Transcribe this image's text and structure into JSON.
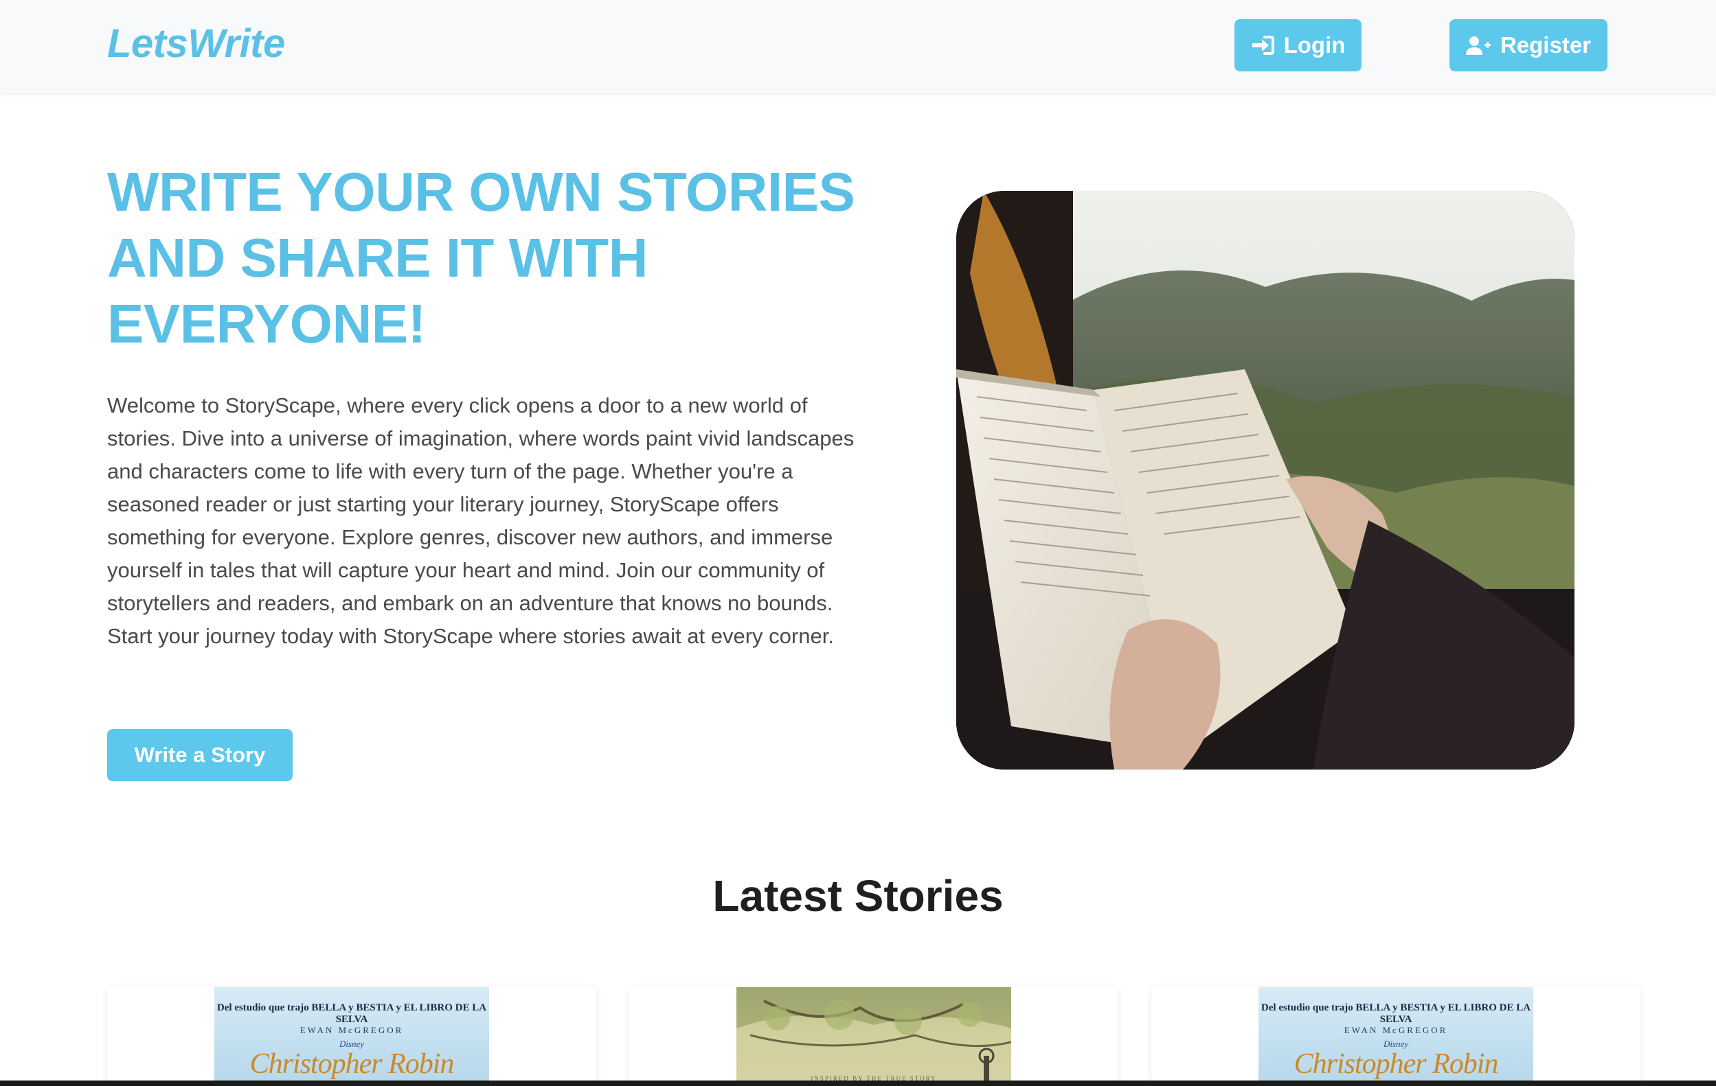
{
  "navbar": {
    "brand": "LetsWrite",
    "login_label": "Login",
    "register_label": "Register"
  },
  "hero": {
    "title": "WRITE YOUR OWN STORIES AND SHARE IT WITH EVERYONE!",
    "description": "Welcome to StoryScape, where every click opens a door to a new world of stories. Dive into a universe of imagination, where words paint vivid landscapes and characters come to life with every turn of the page. Whether you're a seasoned reader or just starting your literary journey, StoryScape offers something for everyone. Explore genres, discover new authors, and immerse yourself in tales that will capture your heart and mind. Join our community of storytellers and readers, and embark on an adventure that knows no bounds. Start your journey today with StoryScape where stories await at every corner.",
    "cta_label": "Write a Story"
  },
  "latest": {
    "title": "Latest Stories",
    "cards": [
      {
        "poster_top": "Del estudio que trajo BELLA y BESTIA y EL LIBRO DE LA SELVA",
        "poster_actor": "EWAN McGREGOR",
        "poster_studio": "Disney",
        "poster_title": "Christopher Robin"
      },
      {
        "poster_caption": "INSPIRED BY THE TRUE STORY"
      },
      {
        "poster_top": "Del estudio que trajo BELLA y BESTIA y EL LIBRO DE LA SELVA",
        "poster_actor": "EWAN McGREGOR",
        "poster_studio": "Disney",
        "poster_title": "Christopher Robin"
      }
    ]
  },
  "colors": {
    "accent": "#5bc8ec",
    "brand": "#5bc0e6",
    "navbar_bg": "#f8f9fa",
    "body_text": "#4a4a4a",
    "heading_dark": "#1f1f1f"
  },
  "icons": {
    "login": "sign-in-icon",
    "register": "user-plus-icon"
  }
}
